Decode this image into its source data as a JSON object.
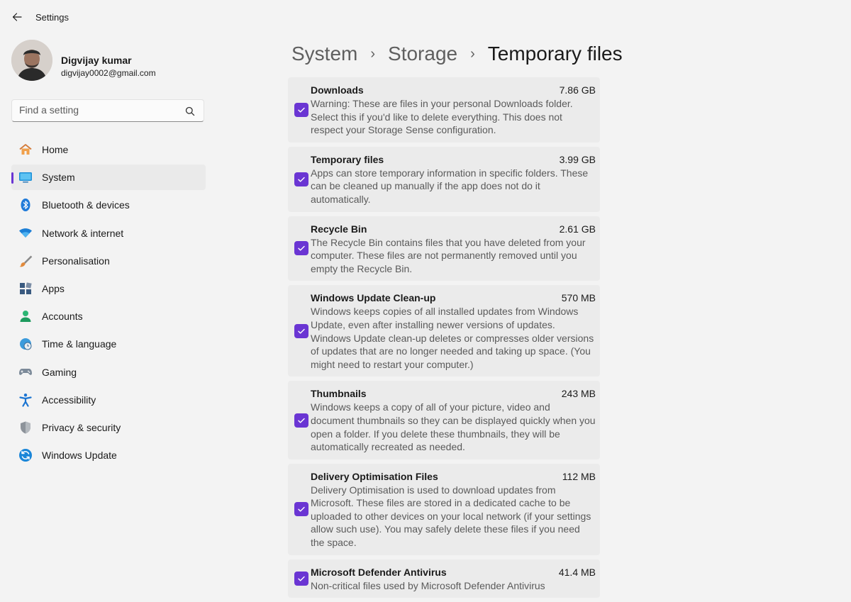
{
  "window": {
    "title": "Settings"
  },
  "profile": {
    "name": "Digvijay kumar",
    "email": "digvijay0002@gmail.com"
  },
  "search": {
    "placeholder": "Find a setting"
  },
  "sidebar": {
    "items": [
      {
        "label": "Home",
        "icon": "home-icon"
      },
      {
        "label": "System",
        "icon": "system-icon",
        "active": true
      },
      {
        "label": "Bluetooth & devices",
        "icon": "bluetooth-icon"
      },
      {
        "label": "Network & internet",
        "icon": "wifi-icon"
      },
      {
        "label": "Personalisation",
        "icon": "brush-icon"
      },
      {
        "label": "Apps",
        "icon": "apps-icon"
      },
      {
        "label": "Accounts",
        "icon": "person-icon"
      },
      {
        "label": "Time & language",
        "icon": "globe-clock-icon"
      },
      {
        "label": "Gaming",
        "icon": "gamepad-icon"
      },
      {
        "label": "Accessibility",
        "icon": "accessibility-icon"
      },
      {
        "label": "Privacy & security",
        "icon": "shield-icon"
      },
      {
        "label": "Windows Update",
        "icon": "update-icon"
      }
    ]
  },
  "breadcrumb": {
    "level1": "System",
    "level2": "Storage",
    "current": "Temporary files",
    "separator": "›"
  },
  "items": [
    {
      "title": "Downloads",
      "size": "7.86 GB",
      "checked": true,
      "desc": "Warning: These are files in your personal Downloads folder. Select this if you'd like to delete everything. This does not respect your Storage Sense configuration."
    },
    {
      "title": "Temporary files",
      "size": "3.99 GB",
      "checked": true,
      "desc": "Apps can store temporary information in specific folders. These can be cleaned up manually if the app does not do it automatically."
    },
    {
      "title": "Recycle Bin",
      "size": "2.61 GB",
      "checked": true,
      "desc": "The Recycle Bin contains files that you have deleted from your computer. These files are not permanently removed until you empty the Recycle Bin."
    },
    {
      "title": "Windows Update Clean-up",
      "size": "570 MB",
      "checked": true,
      "desc": "Windows keeps copies of all installed updates from Windows Update, even after installing newer versions of updates. Windows Update clean-up deletes or compresses older versions of updates that are no longer needed and taking up space. (You might need to restart your computer.)"
    },
    {
      "title": "Thumbnails",
      "size": "243 MB",
      "checked": true,
      "desc": "Windows keeps a copy of all of your picture, video and document thumbnails so they can be displayed quickly when you open a folder. If you delete these thumbnails, they will be automatically recreated as needed."
    },
    {
      "title": "Delivery Optimisation Files",
      "size": "112 MB",
      "checked": true,
      "desc": "Delivery Optimisation is used to download updates from Microsoft. These files are stored in a dedicated cache to be uploaded to other devices on your local network (if your settings allow such use). You may safely delete these files if you need the space."
    },
    {
      "title": "Microsoft Defender Antivirus",
      "size": "41.4 MB",
      "checked": true,
      "desc": "Non-critical files used by Microsoft Defender Antivirus"
    }
  ],
  "colors": {
    "accent": "#6a35d3",
    "background": "#f3f3f3",
    "card": "#ebebeb"
  }
}
